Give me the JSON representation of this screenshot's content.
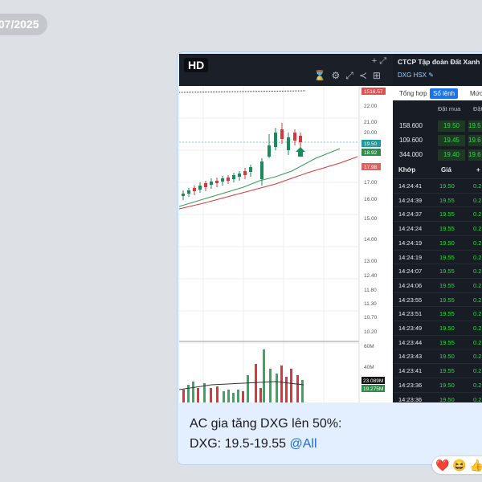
{
  "date_pill": "/07/2025",
  "chart": {
    "hd_label": "HD",
    "corner_icons": "+ ⤢",
    "price_axis": [
      "22.00",
      "21.00",
      "20.00",
      "19.00",
      "18.00",
      "17.00",
      "16.00",
      "15.00",
      "14.00",
      "13.00",
      "12.40",
      "11.80",
      "11.30",
      "10.70",
      "10.20"
    ],
    "tags": {
      "top": "1516.57",
      "last": "19.50",
      "ma1": "18.92",
      "ma2": "17.98"
    },
    "volume_axis": {
      "top": "60M",
      "mid": "40M",
      "tag1": "23.089M",
      "tag2": "19.275M"
    }
  },
  "panel": {
    "title": "CTCP Tập đoàn Đất Xanh",
    "ticker": "DXG HSX",
    "tabs": [
      "Tổng hợp",
      "Sổ lệnh",
      "Mức"
    ],
    "ob_headers": [
      "Đặt mua",
      "Đặt"
    ],
    "orderbook": [
      {
        "vol": "158.600",
        "price": "19.50",
        "price2": "19.5"
      },
      {
        "vol": "109.600",
        "price": "19.45",
        "price2": "19.6"
      },
      {
        "vol": "344.000",
        "price": "19.40",
        "price2": "19.6"
      }
    ],
    "trade_headers": [
      "Khớp",
      "Giá",
      "+"
    ],
    "trades": [
      {
        "time": "14:24:41",
        "price": "19.50",
        "chg": "0.2"
      },
      {
        "time": "14:24:39",
        "price": "19.55",
        "chg": "0.2"
      },
      {
        "time": "14:24:37",
        "price": "19.55",
        "chg": "0.2"
      },
      {
        "time": "14:24:24",
        "price": "19.55",
        "chg": "0.2"
      },
      {
        "time": "14:24:19",
        "price": "19.50",
        "chg": "0.2"
      },
      {
        "time": "14:24:19",
        "price": "19.55",
        "chg": "0.2"
      },
      {
        "time": "14:24:07",
        "price": "19.55",
        "chg": "0.2"
      },
      {
        "time": "14:24:06",
        "price": "19.55",
        "chg": "0.2"
      },
      {
        "time": "14:23:55",
        "price": "19.55",
        "chg": "0.2"
      },
      {
        "time": "14:23:51",
        "price": "19.55",
        "chg": "0.2"
      },
      {
        "time": "14:23:49",
        "price": "19.50",
        "chg": "0.2"
      },
      {
        "time": "14:23:44",
        "price": "19.55",
        "chg": "0.2"
      },
      {
        "time": "14:23:43",
        "price": "19.50",
        "chg": "0.2"
      },
      {
        "time": "14:23:41",
        "price": "19.55",
        "chg": "0.2"
      },
      {
        "time": "14:23:36",
        "price": "19.50",
        "chg": "0.2"
      },
      {
        "time": "14:23:36",
        "price": "19.50",
        "chg": "0.2"
      }
    ]
  },
  "caption": {
    "line1": "AC gia tăng DXG lên 50%:",
    "line2": "DXG: 19.5-19.55 ",
    "mention": "@All"
  },
  "reactions": [
    "❤️",
    "😆",
    "👍"
  ]
}
